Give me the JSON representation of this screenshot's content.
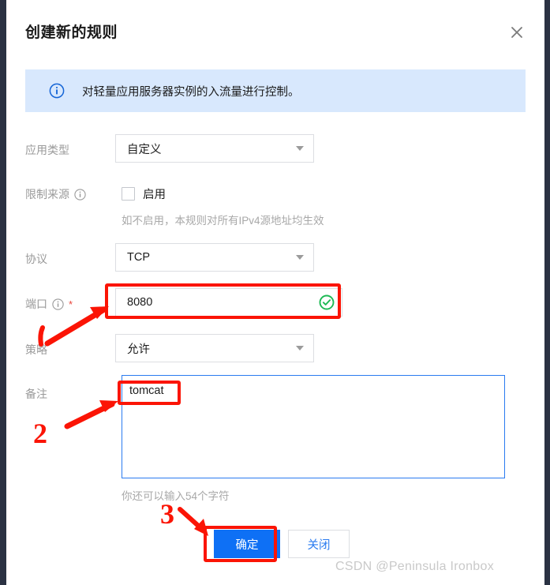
{
  "window": {
    "title": "创建新的规则",
    "close_icon": "close-x-icon"
  },
  "banner": {
    "icon": "info-circle-icon",
    "text": "对轻量应用服务器实例的入流量进行控制。"
  },
  "form": {
    "app_type": {
      "label": "应用类型",
      "value": "自定义",
      "caret_icon": "chevron-down-icon"
    },
    "restrict_source": {
      "label": "限制来源",
      "info_icon": "info-circle-small-icon",
      "checkbox_label": "启用",
      "checked": false,
      "help_text": "如不启用，本规则对所有IPv4源地址均生效"
    },
    "protocol": {
      "label": "协议",
      "value": "TCP",
      "caret_icon": "chevron-down-icon"
    },
    "port": {
      "label": "端口",
      "info_icon": "info-circle-small-icon",
      "required_mark": "*",
      "value": "8080",
      "status_icon": "check-circle-green-icon"
    },
    "policy": {
      "label": "策略",
      "value": "允许",
      "caret_icon": "chevron-down-icon"
    },
    "remark": {
      "label": "备注",
      "value": "tomcat",
      "counter_text": "你还可以输入54个字符"
    }
  },
  "footer": {
    "confirm_label": "确定",
    "close_label": "关闭"
  },
  "annotations": {
    "markers": [
      {
        "id": "1",
        "text": "1"
      },
      {
        "id": "2",
        "text": "2"
      },
      {
        "id": "3",
        "text": "3"
      }
    ]
  },
  "watermark": {
    "text": "CSDN @Peninsula Ironbox"
  },
  "colors": {
    "accent_blue": "#0e70f5",
    "banner_bg": "#d8e8fd",
    "annotation_red": "#fb1405",
    "success_green": "#1db954",
    "required_red": "#e8453c",
    "sidebar_dark": "#2b3243"
  }
}
